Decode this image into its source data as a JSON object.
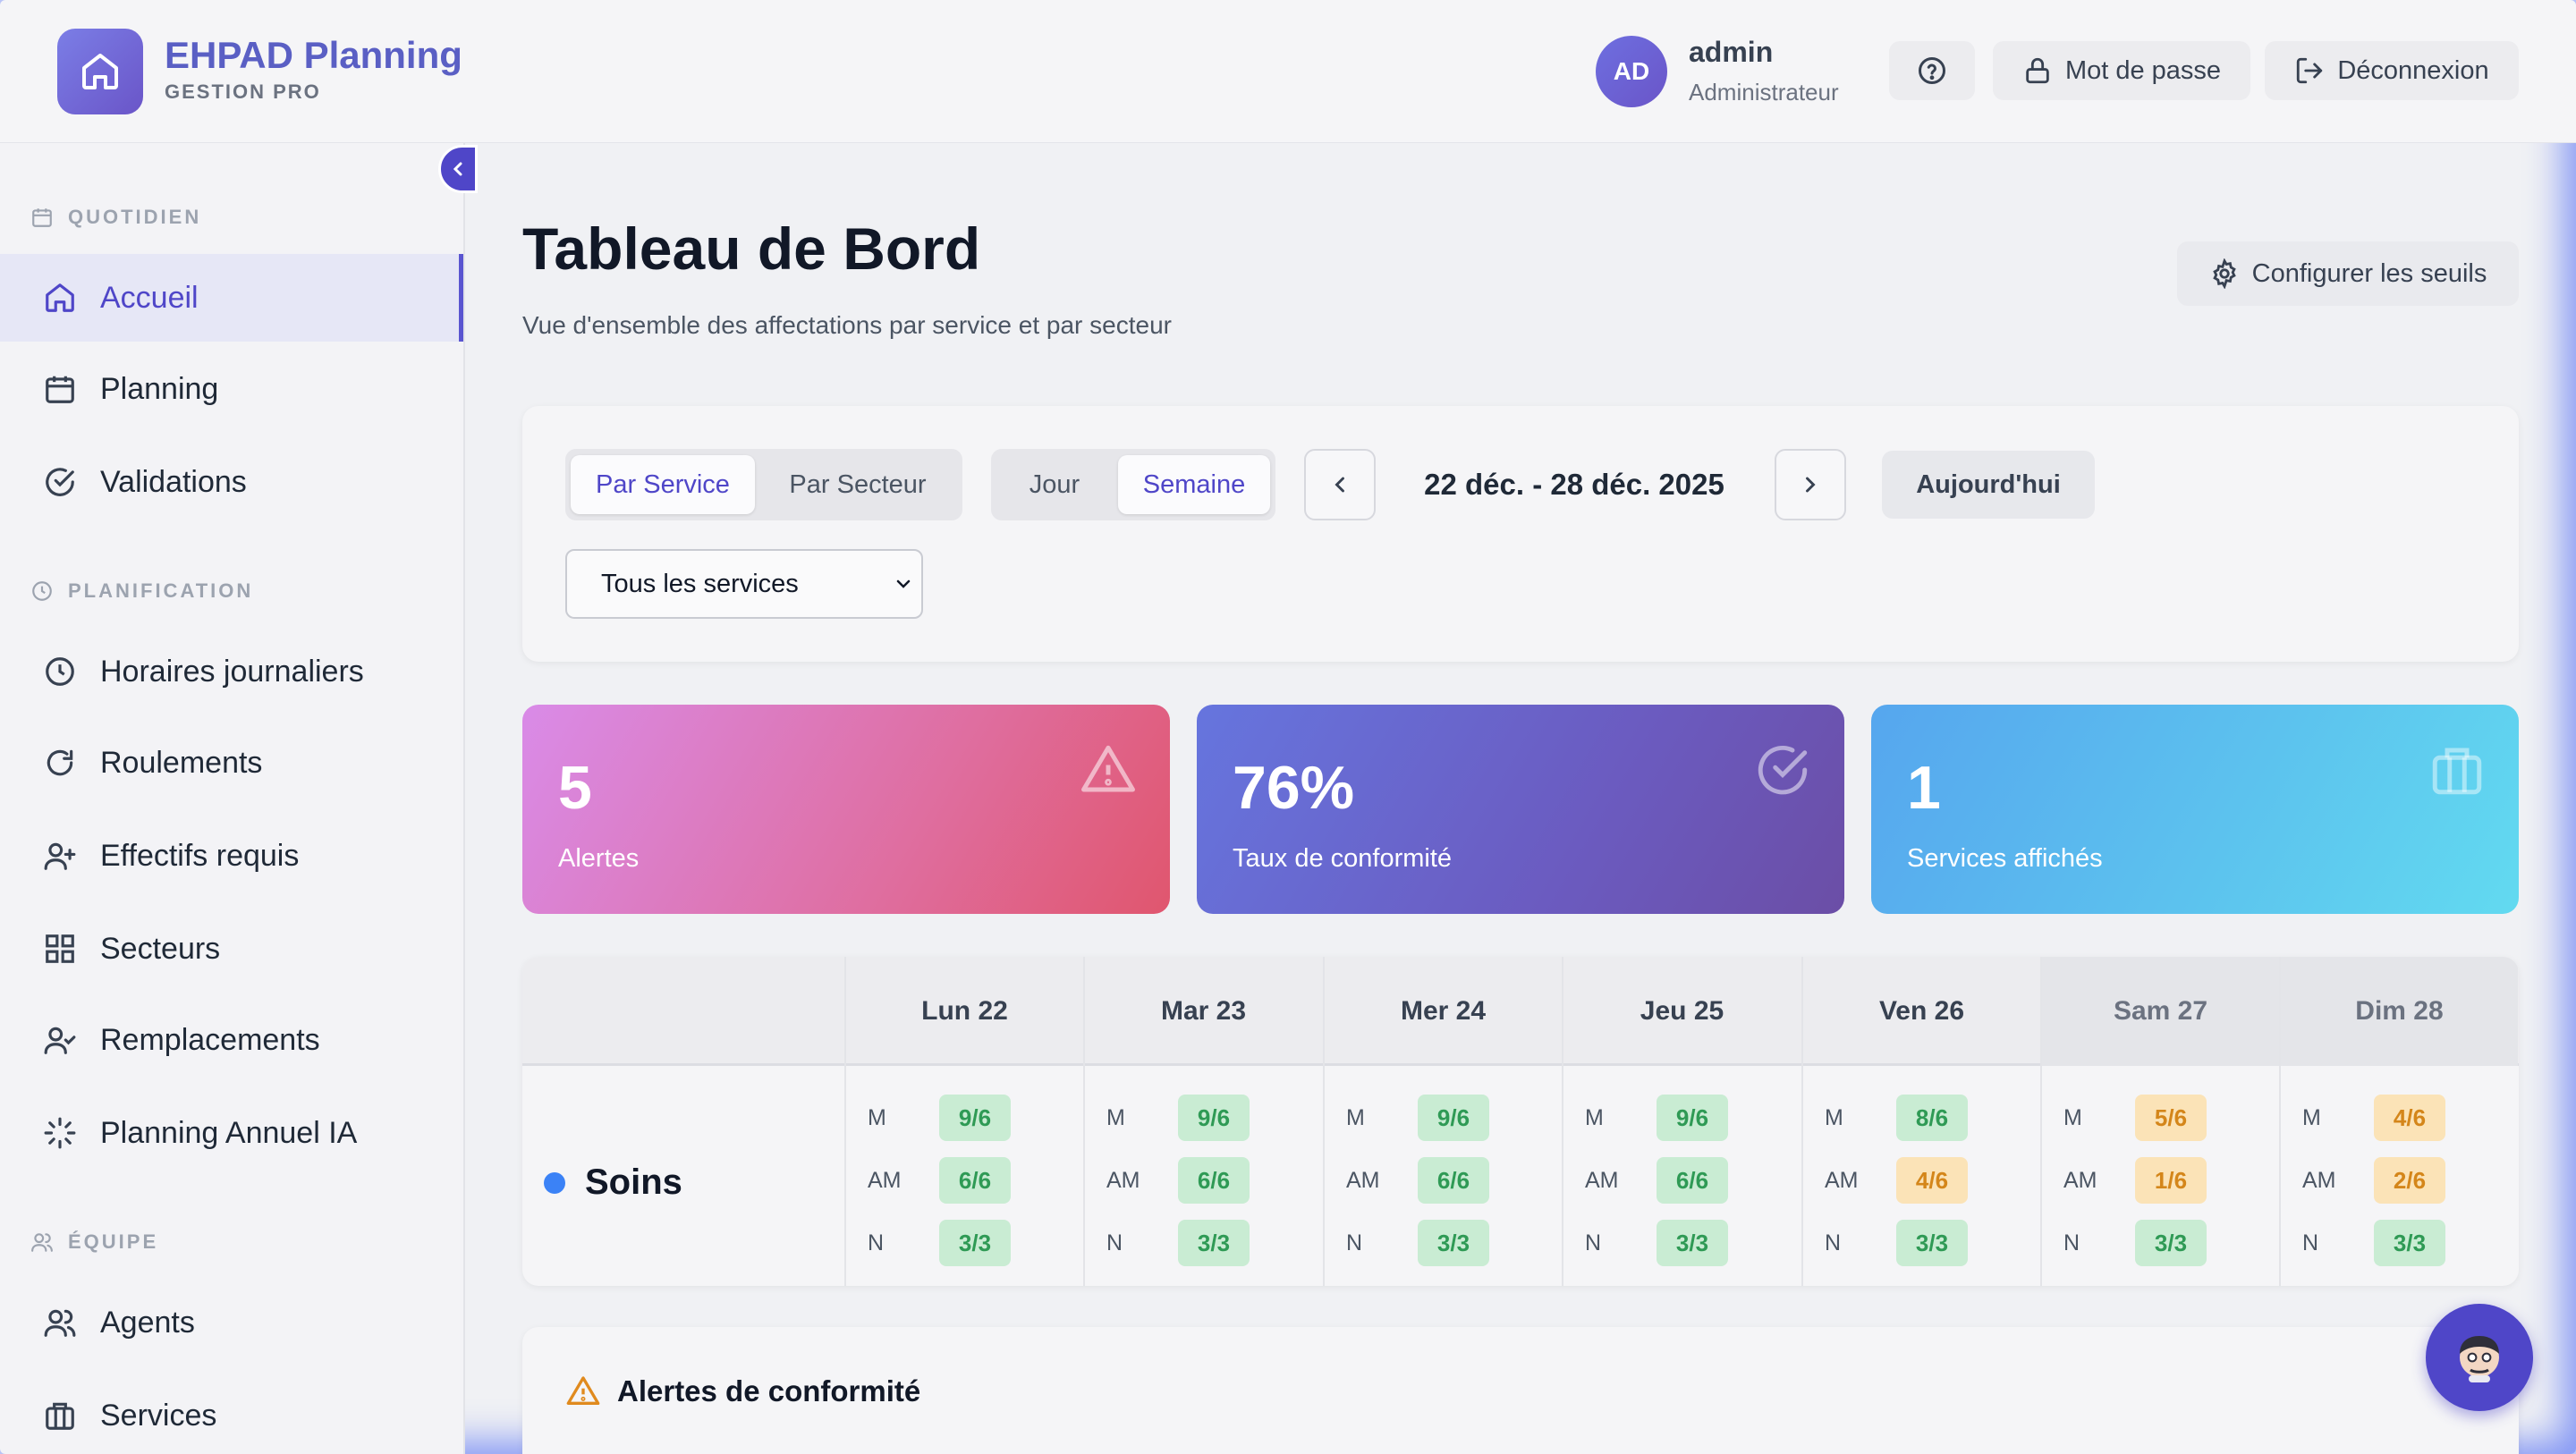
{
  "header": {
    "brand_title": "EHPAD Planning",
    "brand_subtitle": "GESTION PRO",
    "avatar_initials": "AD",
    "user_name": "admin",
    "user_role": "Administrateur",
    "password_label": "Mot de passe",
    "logout_label": "Déconnexion",
    "icons": [
      "home-icon",
      "help-icon",
      "lock-icon",
      "logout-icon"
    ]
  },
  "sidebar": {
    "sections": [
      {
        "label": "QUOTIDIEN",
        "icon": "calendar-icon"
      },
      {
        "label": "PLANIFICATION",
        "icon": "clock-icon"
      },
      {
        "label": "ÉQUIPE",
        "icon": "users-icon"
      }
    ],
    "items": [
      {
        "label": "Accueil",
        "icon": "home-icon",
        "active": true
      },
      {
        "label": "Planning",
        "icon": "calendar-icon"
      },
      {
        "label": "Validations",
        "icon": "check-circle-icon"
      },
      {
        "label": "Horaires journaliers",
        "icon": "clock-icon"
      },
      {
        "label": "Roulements",
        "icon": "refresh-icon"
      },
      {
        "label": "Effectifs requis",
        "icon": "user-plus-icon"
      },
      {
        "label": "Secteurs",
        "icon": "grid-icon"
      },
      {
        "label": "Remplacements",
        "icon": "user-check-icon"
      },
      {
        "label": "Planning Annuel IA",
        "icon": "loader-icon"
      },
      {
        "label": "Agents",
        "icon": "users-icon"
      },
      {
        "label": "Services",
        "icon": "briefcase-icon"
      }
    ]
  },
  "page": {
    "title": "Tableau de Bord",
    "subtitle": "Vue d'ensemble des affectations par service et par secteur",
    "configure_label": "Configurer les seuils"
  },
  "filters": {
    "view_options": [
      "Par Service",
      "Par Secteur"
    ],
    "view_selected": "Par Service",
    "period_options": [
      "Jour",
      "Semaine"
    ],
    "period_selected": "Semaine",
    "date_range": "22 déc. - 28 déc. 2025",
    "today_label": "Aujourd'hui",
    "service_select": "Tous les services"
  },
  "stats": [
    {
      "value": "5",
      "label": "Alertes",
      "icon": "alert-triangle-icon"
    },
    {
      "value": "76%",
      "label": "Taux de conformité",
      "icon": "check-circle-icon"
    },
    {
      "value": "1",
      "label": "Services affichés",
      "icon": "briefcase-icon"
    }
  ],
  "schedule": {
    "days": [
      "Lun 22",
      "Mar 23",
      "Mer 24",
      "Jeu 25",
      "Ven 26",
      "Sam 27",
      "Dim 28"
    ],
    "shift_labels": [
      "M",
      "AM",
      "N"
    ],
    "service": {
      "name": "Soins",
      "color": "#3b82f6"
    },
    "cells": [
      [
        {
          "v": "9/6",
          "s": "ok"
        },
        {
          "v": "6/6",
          "s": "ok"
        },
        {
          "v": "3/3",
          "s": "ok"
        }
      ],
      [
        {
          "v": "9/6",
          "s": "ok"
        },
        {
          "v": "6/6",
          "s": "ok"
        },
        {
          "v": "3/3",
          "s": "ok"
        }
      ],
      [
        {
          "v": "9/6",
          "s": "ok"
        },
        {
          "v": "6/6",
          "s": "ok"
        },
        {
          "v": "3/3",
          "s": "ok"
        }
      ],
      [
        {
          "v": "9/6",
          "s": "ok"
        },
        {
          "v": "6/6",
          "s": "ok"
        },
        {
          "v": "3/3",
          "s": "ok"
        }
      ],
      [
        {
          "v": "8/6",
          "s": "ok"
        },
        {
          "v": "4/6",
          "s": "warn"
        },
        {
          "v": "3/3",
          "s": "ok"
        }
      ],
      [
        {
          "v": "5/6",
          "s": "warn"
        },
        {
          "v": "1/6",
          "s": "warn"
        },
        {
          "v": "3/3",
          "s": "ok"
        }
      ],
      [
        {
          "v": "4/6",
          "s": "warn"
        },
        {
          "v": "2/6",
          "s": "warn"
        },
        {
          "v": "3/3",
          "s": "ok"
        }
      ]
    ]
  },
  "alerts": {
    "title": "Alertes de conformité"
  },
  "colors": {
    "accent": "#4f46c8",
    "badge_ok_bg": "#c9ecd3",
    "badge_warn_bg": "#fbe3b7"
  }
}
